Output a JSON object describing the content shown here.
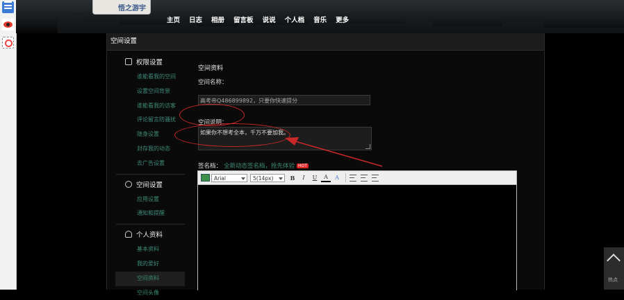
{
  "sidebar_strip": {
    "icons": [
      "menu-icon",
      "weibo-icon",
      "target-icon"
    ]
  },
  "header": {
    "logo_text": "悟之游宇",
    "nav": [
      "主页",
      "日志",
      "相册",
      "留言板",
      "说说",
      "个人档",
      "音乐",
      "更多"
    ]
  },
  "panel": {
    "title": "空间设置"
  },
  "side_menu": {
    "sections": [
      {
        "title": "权限设置",
        "icon": "lock-icon",
        "items": [
          "谁能看我的空间",
          "设置空间背景",
          "谁能看我的访客",
          "评论留言防骚扰",
          "隐身设置",
          "封存我的动态",
          "去广告设置"
        ]
      },
      {
        "title": "空间设置",
        "icon": "link-icon",
        "items": [
          "应用设置",
          "通知和提醒"
        ]
      },
      {
        "title": "个人资料",
        "icon": "person-icon",
        "items": [
          "基本资料",
          "我的爱好",
          "空间资料",
          "空间头像"
        ]
      }
    ],
    "active_item": "空间资料"
  },
  "form": {
    "section_title": "空间资料",
    "name_label": "空间名称：",
    "name_value": "高考帝Q486899892，只要你快速提分",
    "desc_label": "空间说明：",
    "desc_value": "如果你不想考全本，千万不要加我。",
    "sig_label": "签名档：",
    "sig_promo": "全新动态签名档，抢先体验",
    "hot_badge": "HOT"
  },
  "editor": {
    "font_family": "Arial",
    "font_size": "5(14px)",
    "bold_label": "B",
    "italic_label": "I",
    "underline_label": "U",
    "color_label": "A"
  },
  "float_button": {
    "label": "热点"
  },
  "colors": {
    "annotation_red": "#c82828",
    "link_teal": "#3e8a78"
  }
}
